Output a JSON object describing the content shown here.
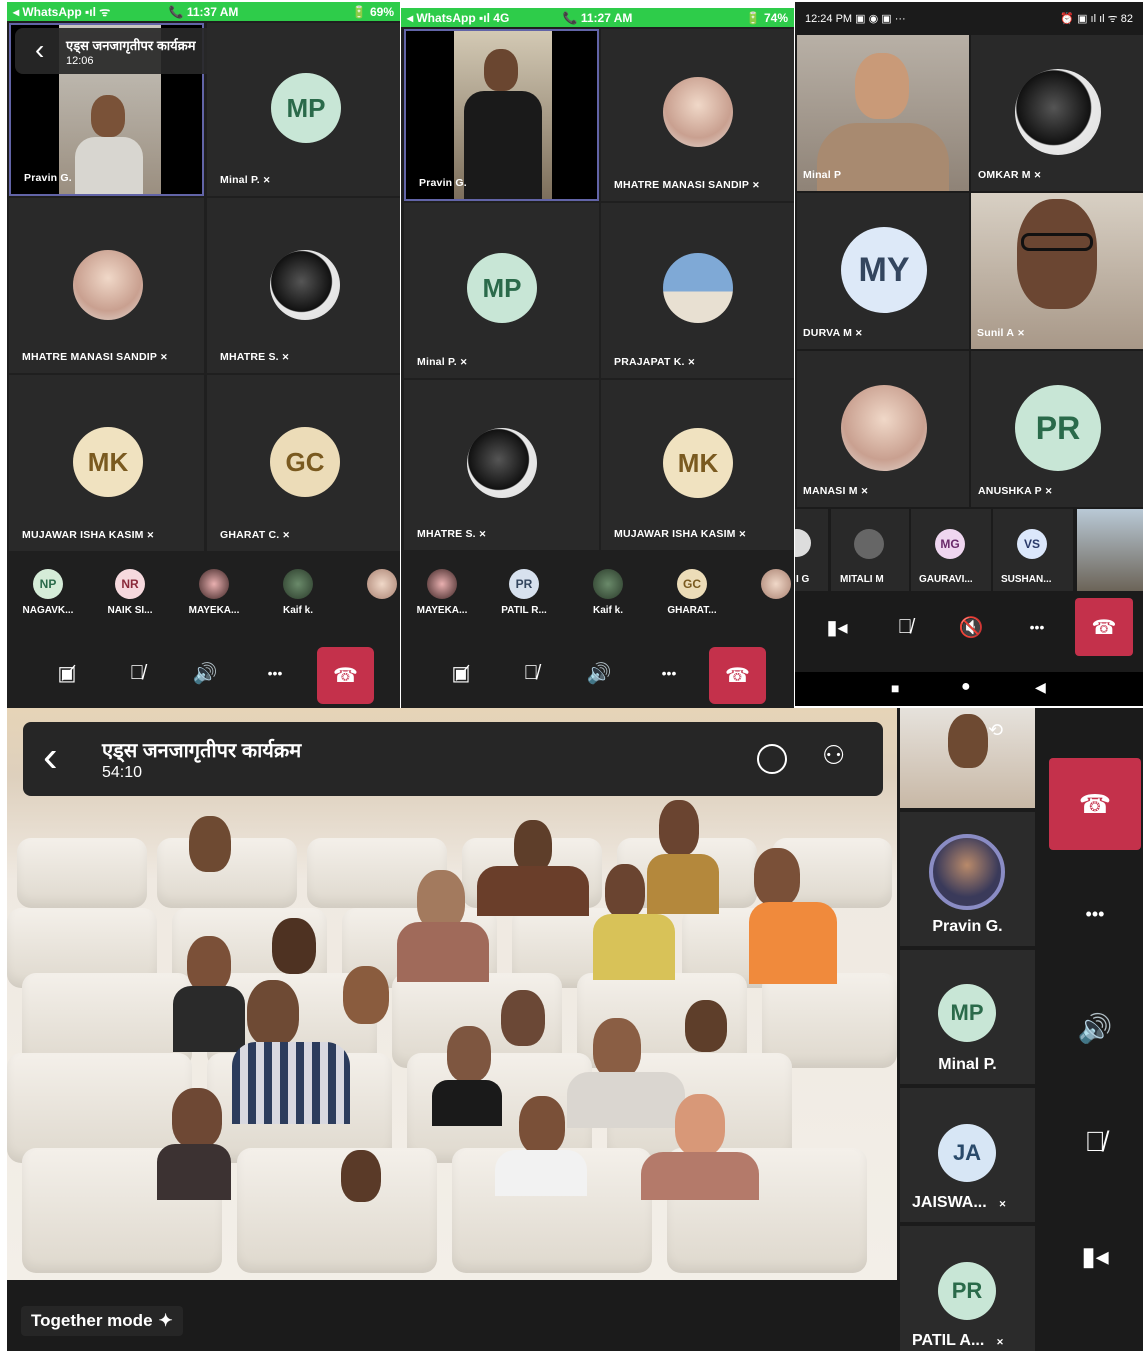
{
  "panel1": {
    "status": {
      "left": "◂ WhatsApp ▪ıl ᯤ",
      "center": "📞 11:37 AM",
      "right": "🔋 69%"
    },
    "meeting_title": "एड्स जनजागृतीपर कार्यक्रम",
    "timer": "12:06",
    "tiles": [
      {
        "name": "Pravin G.",
        "kind": "video"
      },
      {
        "name": "Minal P.",
        "initials": "MP"
      },
      {
        "name": "MHATRE MANASI SANDIP",
        "kind": "photo"
      },
      {
        "name": "MHATRE S.",
        "kind": "photo"
      },
      {
        "name": "MUJAWAR ISHA KASIM",
        "initials": "MK"
      },
      {
        "name": "GHARAT C.",
        "initials": "GC"
      }
    ],
    "strip": [
      {
        "initials": "NP",
        "name": "NAGAVK..."
      },
      {
        "initials": "NR",
        "name": "NAIK SI..."
      },
      {
        "initials": "",
        "name": "MAYEKA..."
      },
      {
        "initials": "",
        "name": "Kaif k."
      },
      {
        "initials": "",
        "name": ""
      }
    ]
  },
  "panel2": {
    "status": {
      "left": "◂ WhatsApp ▪ıl 4G",
      "center": "📞 11:27 AM",
      "right": "🔋 74%"
    },
    "tiles": [
      {
        "name": "Pravin G.",
        "kind": "video"
      },
      {
        "name": "MHATRE MANASI SANDIP",
        "kind": "photo"
      },
      {
        "name": "Minal P.",
        "initials": "MP"
      },
      {
        "name": "PRAJAPAT K.",
        "kind": "photo"
      },
      {
        "name": "MHATRE S.",
        "kind": "photo"
      },
      {
        "name": "MUJAWAR ISHA KASIM",
        "initials": "MK"
      }
    ],
    "strip": [
      {
        "initials": "",
        "name": "MAYEKA..."
      },
      {
        "initials": "PR",
        "name": "PATIL R..."
      },
      {
        "initials": "",
        "name": "Kaif k."
      },
      {
        "initials": "GC",
        "name": "GHARAT..."
      },
      {
        "initials": "",
        "name": ""
      }
    ]
  },
  "panel3": {
    "status": {
      "left": "12:24 PM ▣ ◉ ▣ ···",
      "right": "⏰ ▣ ıl ıl ᯤ 82"
    },
    "tiles": [
      {
        "name": "Minal P",
        "kind": "video"
      },
      {
        "name": "OMKAR M",
        "kind": "photo"
      },
      {
        "name": "DURVA M",
        "initials": "MY"
      },
      {
        "name": "Sunil A",
        "kind": "video"
      },
      {
        "name": "MANASI M",
        "kind": "photo"
      },
      {
        "name": "ANUSHKA P",
        "initials": "PR"
      }
    ],
    "strip": [
      {
        "initials": "",
        "name": "I G"
      },
      {
        "initials": "",
        "name": "MITALI M"
      },
      {
        "initials": "MG",
        "name": "GAURAVI..."
      },
      {
        "initials": "VS",
        "name": "SUSHAN..."
      }
    ],
    "nav": {
      "square": "■",
      "circle": "●",
      "back": "◀"
    }
  },
  "panel4": {
    "meeting_title": "एड्स जनजागृतीपर कार्यक्रम",
    "timer": "54:10",
    "together_label": "Together mode",
    "rail": [
      {
        "name": "Pravin G.",
        "initials": ""
      },
      {
        "name": "Minal P.",
        "initials": "MP"
      },
      {
        "name": "JAISWA...",
        "initials": "JA"
      },
      {
        "name": "PATIL A...",
        "initials": "PR"
      }
    ]
  },
  "icons": {
    "mic_off": "🎙̸",
    "dots": "•••",
    "speaker": "🔊",
    "back": "‹"
  },
  "colors": {
    "mp": "#c8e6d6",
    "mk": "#f0e2c0",
    "gc": "#ecdcb8",
    "my": "#dde9f8",
    "pr": "#c8e6d6",
    "np": "#d5ecd8",
    "nr": "#f6d9de",
    "mg": "#efd6f0",
    "vs": "#dbe7fb",
    "ja": "#d7e6f5",
    "end": "#c4314b"
  }
}
